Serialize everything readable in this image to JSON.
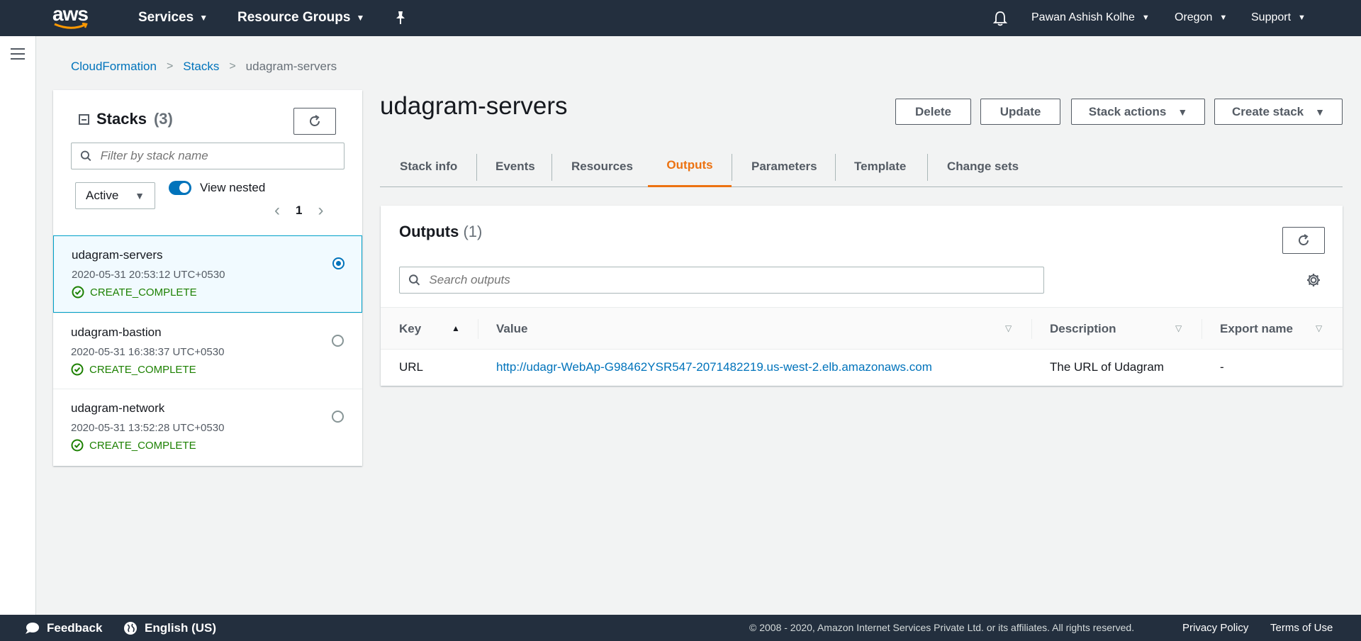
{
  "nav": {
    "logo": "aws",
    "services": "Services",
    "resource_groups": "Resource Groups",
    "user": "Pawan Ashish Kolhe",
    "region": "Oregon",
    "support": "Support"
  },
  "breadcrumb": [
    "CloudFormation",
    "Stacks",
    "udagram-servers"
  ],
  "stacks": {
    "title": "Stacks",
    "count": "(3)",
    "filter_placeholder": "Filter by stack name",
    "status_filter": "Active",
    "view_nested": "View nested",
    "page": "1",
    "items": [
      {
        "name": "udagram-servers",
        "date": "2020-05-31 20:53:12 UTC+0530",
        "status": "CREATE_COMPLETE",
        "selected": true
      },
      {
        "name": "udagram-bastion",
        "date": "2020-05-31 16:38:37 UTC+0530",
        "status": "CREATE_COMPLETE",
        "selected": false
      },
      {
        "name": "udagram-network",
        "date": "2020-05-31 13:52:28 UTC+0530",
        "status": "CREATE_COMPLETE",
        "selected": false
      }
    ]
  },
  "main": {
    "title": "udagram-servers",
    "buttons": {
      "delete": "Delete",
      "update": "Update",
      "stack_actions": "Stack actions",
      "create_stack": "Create stack"
    },
    "tabs": [
      "Stack info",
      "Events",
      "Resources",
      "Outputs",
      "Parameters",
      "Template",
      "Change sets"
    ],
    "active_tab": "Outputs"
  },
  "outputs": {
    "title": "Outputs",
    "count": "(1)",
    "search_placeholder": "Search outputs",
    "columns": [
      "Key",
      "Value",
      "Description",
      "Export name"
    ],
    "rows": [
      {
        "key": "URL",
        "value": "http://udagr-WebAp-G98462YSR547-2071482219.us-west-2.elb.amazonaws.com",
        "description": "The URL of Udagram",
        "export": "-"
      }
    ]
  },
  "footer": {
    "feedback": "Feedback",
    "language": "English (US)",
    "copyright": "© 2008 - 2020, Amazon Internet Services Private Ltd. or its affiliates. All rights reserved.",
    "privacy": "Privacy Policy",
    "terms": "Terms of Use"
  },
  "colors": {
    "nav_bg": "#232f3e",
    "accent": "#ec7211",
    "link": "#0073bb",
    "success": "#1d8102"
  }
}
